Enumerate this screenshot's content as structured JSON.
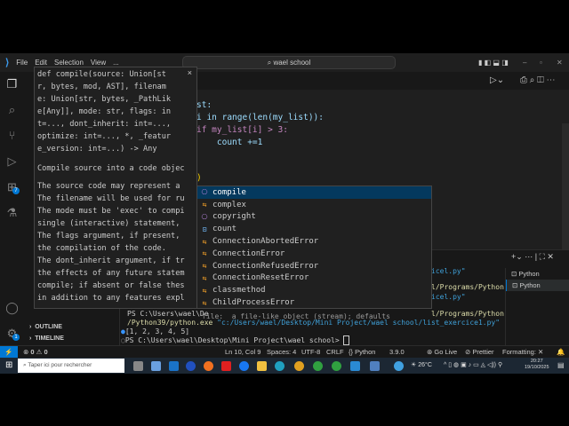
{
  "titlebar": {
    "menus": [
      "File",
      "Edit",
      "Selection",
      "View",
      "..."
    ],
    "search": "wael school"
  },
  "editor": {
    "lines": [
      {
        "text": "st:"
      },
      {
        "text": "i in range(len(my_list)):"
      },
      {
        "text": "if my_list[i] > 3:"
      },
      {
        "text": "    count +=1"
      },
      {
        "text": ")"
      }
    ]
  },
  "hover": {
    "signature": [
      "def compile(source: Union[st",
      "r, bytes, mod, AST], filenam",
      "e: Union[str, bytes, _PathLik",
      "e[Any]], mode: str, flags: in",
      "t=..., dont_inherit: int=...,",
      "optimize: int=..., *, _featur",
      "e_version: int=...) -> Any"
    ],
    "doc": [
      "Compile source into a code objec",
      "",
      "The source code may represent a",
      "The filename will be used for ru",
      "The mode must be 'exec' to compi",
      "single (interactive) statement, ",
      "The flags argument, if present, ",
      "the compilation of the code.",
      "The dont_inherit argument, if tr",
      "the effects of any future statem",
      "compile; if absent or false thes",
      "in addition to any features expl"
    ],
    "close": "×"
  },
  "suggest": [
    {
      "label": "compile",
      "kind": "module",
      "selected": true
    },
    {
      "label": "complex",
      "kind": "class"
    },
    {
      "label": "copyright",
      "kind": "module"
    },
    {
      "label": "count",
      "kind": "variable"
    },
    {
      "label": "ConnectionAbortedError",
      "kind": "class"
    },
    {
      "label": "ConnectionError",
      "kind": "class"
    },
    {
      "label": "ConnectionRefusedError",
      "kind": "class"
    },
    {
      "label": "ConnectionResetError",
      "kind": "class"
    },
    {
      "label": "classmethod",
      "kind": "class"
    },
    {
      "label": "ChildProcessError",
      "kind": "class"
    }
  ],
  "sidebar": {
    "outline": "OUTLINE",
    "timeline": "TIMELINE"
  },
  "activity": {
    "extensions_badge": "7",
    "settings_badge": "1"
  },
  "terminal": {
    "lines": [
      "icel.py\"",
      "l/Programs/Python",
      "icel.py\"",
      "l/Programs/Python"
    ],
    "ps1": "PS C:\\Users\\wael\\De",
    "hint": "file:  a file-like object (stream); defaults",
    "cmd_exe": "/Python39/python.exe",
    "cmd_arg": "\"c:/Users/wael/Desktop/Mini Project/wael school/list_exercice1.py\"",
    "output": "[1, 2, 3, 4, 5]",
    "prompt": "PS C:\\Users\\wael\\Desktop\\Mini Project\\wael school> ",
    "tabs": [
      "Python",
      "Python"
    ]
  },
  "status": {
    "errors": "0",
    "warnings": "0",
    "position": "Ln 10, Col 9",
    "spaces": "Spaces: 4",
    "encoding": "UTF-8",
    "eol": "CRLF",
    "language": "{} Python",
    "version": "3.9.0",
    "golive": "Go Live",
    "prettier": "Prettier",
    "formatting": "Formatting: ✕"
  },
  "taskbar": {
    "search": "Taper ici pour rechercher",
    "weather": "26°C",
    "time": "20:27",
    "date": "19/10/2025"
  }
}
